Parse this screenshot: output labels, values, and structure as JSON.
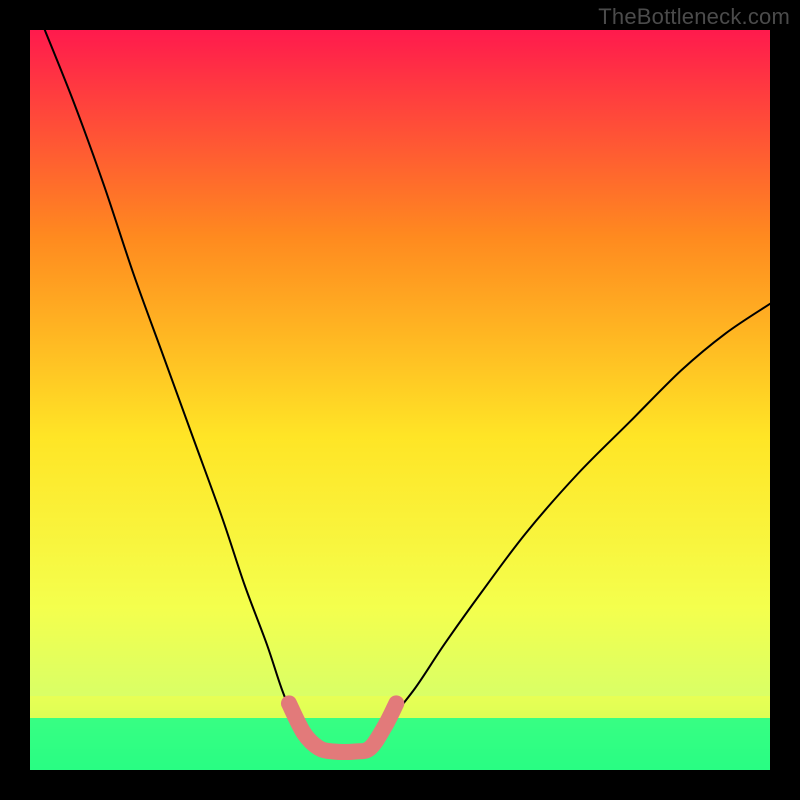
{
  "watermark": "TheBottleneck.com",
  "chart_data": {
    "type": "line",
    "title": "",
    "xlabel": "",
    "ylabel": "",
    "xlim": [
      0,
      100
    ],
    "ylim": [
      0,
      100
    ],
    "background_gradient": {
      "top": "#ff1a4d",
      "mid_upper": "#ff8a1f",
      "mid": "#ffe526",
      "mid_lower": "#f4ff4d",
      "band": "#d9ff66",
      "bottom": "#00e56b"
    },
    "series": [
      {
        "name": "left-curve",
        "color": "#000000",
        "width": 2,
        "points": [
          {
            "x": 2,
            "y": 100
          },
          {
            "x": 6,
            "y": 90
          },
          {
            "x": 10,
            "y": 79
          },
          {
            "x": 14,
            "y": 67
          },
          {
            "x": 18,
            "y": 56
          },
          {
            "x": 22,
            "y": 45
          },
          {
            "x": 26,
            "y": 34
          },
          {
            "x": 29,
            "y": 25
          },
          {
            "x": 32,
            "y": 17
          },
          {
            "x": 34,
            "y": 11
          },
          {
            "x": 36,
            "y": 6
          }
        ]
      },
      {
        "name": "right-curve",
        "color": "#000000",
        "width": 2,
        "points": [
          {
            "x": 48,
            "y": 6
          },
          {
            "x": 52,
            "y": 11
          },
          {
            "x": 56,
            "y": 17
          },
          {
            "x": 61,
            "y": 24
          },
          {
            "x": 67,
            "y": 32
          },
          {
            "x": 74,
            "y": 40
          },
          {
            "x": 81,
            "y": 47
          },
          {
            "x": 88,
            "y": 54
          },
          {
            "x": 94,
            "y": 59
          },
          {
            "x": 100,
            "y": 63
          }
        ]
      },
      {
        "name": "marker-path",
        "color": "#e27a7a",
        "width": 12,
        "points": [
          {
            "x": 35,
            "y": 9
          },
          {
            "x": 37,
            "y": 5
          },
          {
            "x": 39,
            "y": 3
          },
          {
            "x": 41,
            "y": 2.5
          },
          {
            "x": 44,
            "y": 2.5
          },
          {
            "x": 46,
            "y": 3
          },
          {
            "x": 48,
            "y": 6
          },
          {
            "x": 49.5,
            "y": 9
          }
        ]
      }
    ]
  }
}
